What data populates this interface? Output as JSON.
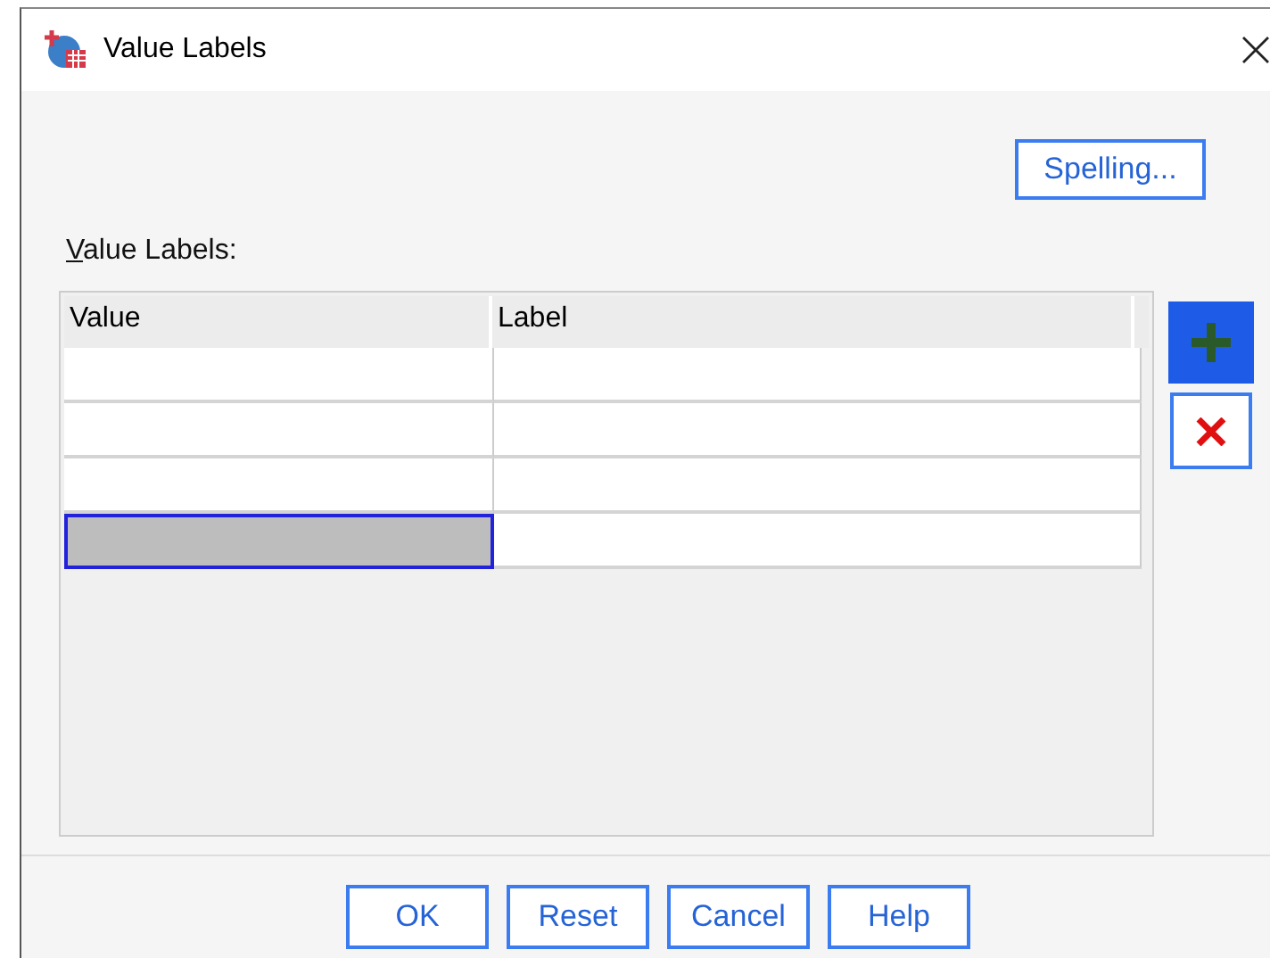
{
  "window": {
    "title": "Value Labels"
  },
  "spelling_button": "Spelling...",
  "list_label": "Value Labels:",
  "table": {
    "columns": [
      "Value",
      "Label"
    ],
    "rows": [
      {
        "cells": [
          {
            "selected": false
          },
          {
            "selected": false
          }
        ]
      },
      {
        "cells": [
          {
            "selected": false
          },
          {
            "selected": false
          }
        ]
      },
      {
        "cells": [
          {
            "selected": false
          },
          {
            "selected": false
          }
        ]
      },
      {
        "cells": [
          {
            "selected": true
          },
          {
            "selected": false
          }
        ]
      }
    ]
  },
  "side_buttons": [
    {
      "kind": "add",
      "highlighted": true
    },
    {
      "kind": "remove",
      "highlighted": false
    }
  ],
  "buttons": [
    "OK",
    "Reset",
    "Cancel",
    "Help"
  ]
}
